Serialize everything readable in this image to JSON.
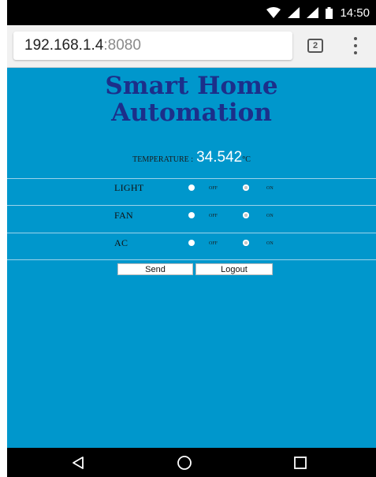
{
  "status_bar": {
    "time": "14:50",
    "icons": [
      "wifi-icon",
      "signal-icon",
      "signal-icon",
      "battery-icon"
    ]
  },
  "address_bar": {
    "url_host": "192.168.1.4",
    "url_port": ":8080",
    "tab_count": "2",
    "menu_icon": "overflow-menu-icon"
  },
  "page": {
    "title_line1": "Smart Home",
    "title_line2": "Automation",
    "temperature_label": "TEMPERATURE :",
    "temperature_value": "34.542",
    "temperature_unit": "°C",
    "devices": [
      {
        "name": "LIGHT",
        "off_label": "OFF",
        "on_label": "ON",
        "selected": "ON"
      },
      {
        "name": "FAN",
        "off_label": "OFF",
        "on_label": "ON",
        "selected": "ON"
      },
      {
        "name": "AC",
        "off_label": "OFF",
        "on_label": "ON",
        "selected": "ON"
      }
    ],
    "send_label": "Send",
    "logout_label": "Logout"
  },
  "nav_bar": {
    "icons": [
      "back-icon",
      "home-icon",
      "recents-icon"
    ]
  },
  "colors": {
    "page_background": "#0097cc",
    "title_color": "#1c2f8a",
    "status_bar": "#000000"
  }
}
